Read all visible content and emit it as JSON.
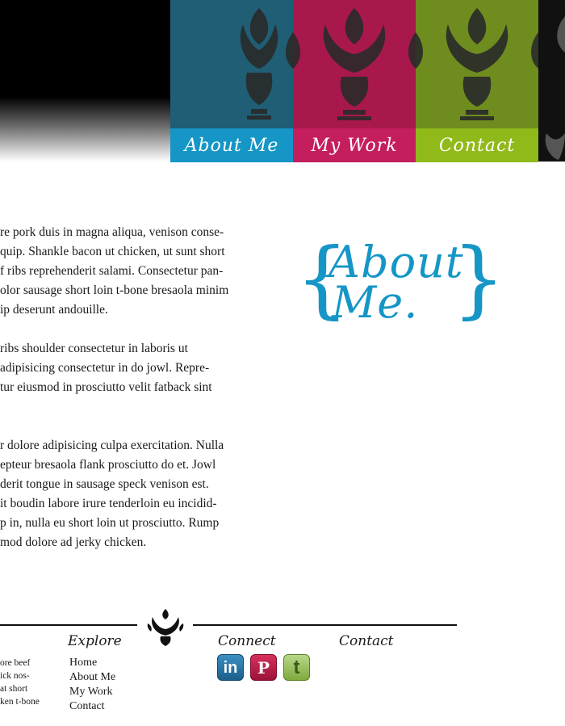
{
  "nav": {
    "about": "About Me",
    "work": "My Work",
    "contact": "Contact"
  },
  "heading": {
    "line1": "About",
    "line2": "Me.",
    "brace_open": "{",
    "brace_close": "}"
  },
  "content": {
    "paragraphs": [
      [
        "re pork duis in magna aliqua, venison conse-",
        "quip. Shankle bacon ut chicken, ut sunt short",
        "f ribs reprehenderit salami. Consectetur pan-",
        "olor sausage short loin t-bone bresaola minim",
        "ip deserunt andouille."
      ],
      [
        " ribs shoulder consectetur in laboris ut",
        " adipisicing consectetur in do jowl. Repre-",
        "tur eiusmod in prosciutto velit fatback sint"
      ],
      [
        "r dolore adipisicing culpa exercitation. Nulla",
        "epteur bresaola flank prosciutto do et. Jowl",
        "derit tongue in sausage speck venison est.",
        "it boudin labore irure tenderloin eu incidid-",
        "p in, nulla eu short loin ut prosciutto. Rump",
        "mod dolore ad jerky chicken."
      ]
    ]
  },
  "footer": {
    "explore_heading": "Explore",
    "connect_heading": "Connect",
    "contact_heading": "Contact",
    "blurb": [
      "ore beef",
      "ick nos-",
      "at short",
      "ken t-bone"
    ],
    "links": [
      "Home",
      "About Me",
      "My Work",
      "Contact"
    ],
    "social": {
      "linkedin": "in",
      "pinterest": "P",
      "twitter": "t"
    }
  },
  "colors": {
    "blue": "#1596c6",
    "magenta": "#c51e5e",
    "green": "#90b91a"
  },
  "icons": [
    "damask-ornament-icon",
    "linkedin-icon",
    "pinterest-icon",
    "twitter-icon"
  ]
}
